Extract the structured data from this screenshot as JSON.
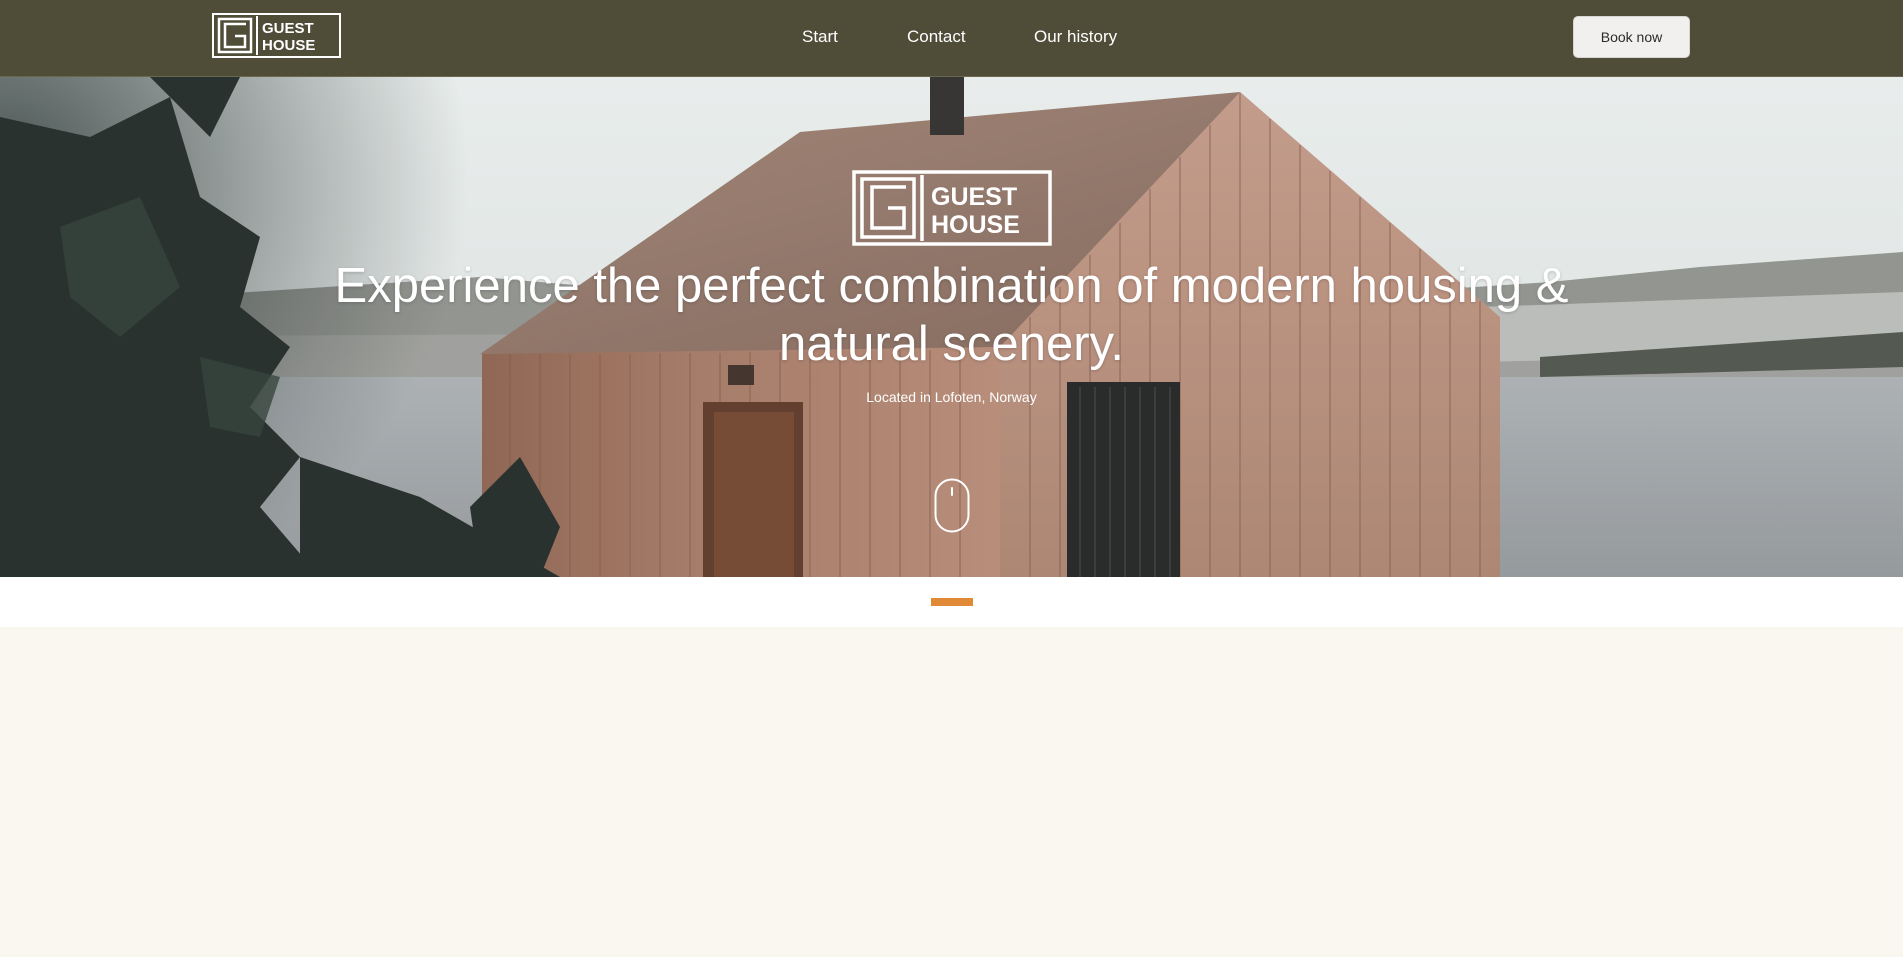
{
  "nav": {
    "logo_text": [
      "GUEST",
      "HOUSE"
    ],
    "links": [
      {
        "label": "Start"
      },
      {
        "label": "Contact"
      },
      {
        "label": "Our history"
      }
    ],
    "cta_label": "Book now"
  },
  "hero": {
    "logo_text": [
      "GUEST",
      "HOUSE"
    ],
    "title": "Experience the perfect combination of modern housing & natural scenery.",
    "subtitle": "Located in Lofoten, Norway",
    "scroll_icon": "mouse-scroll-icon"
  },
  "colors": {
    "nav_bg": "#4f4c38",
    "accent": "#e08a38",
    "page_bg": "#faf7f1"
  }
}
